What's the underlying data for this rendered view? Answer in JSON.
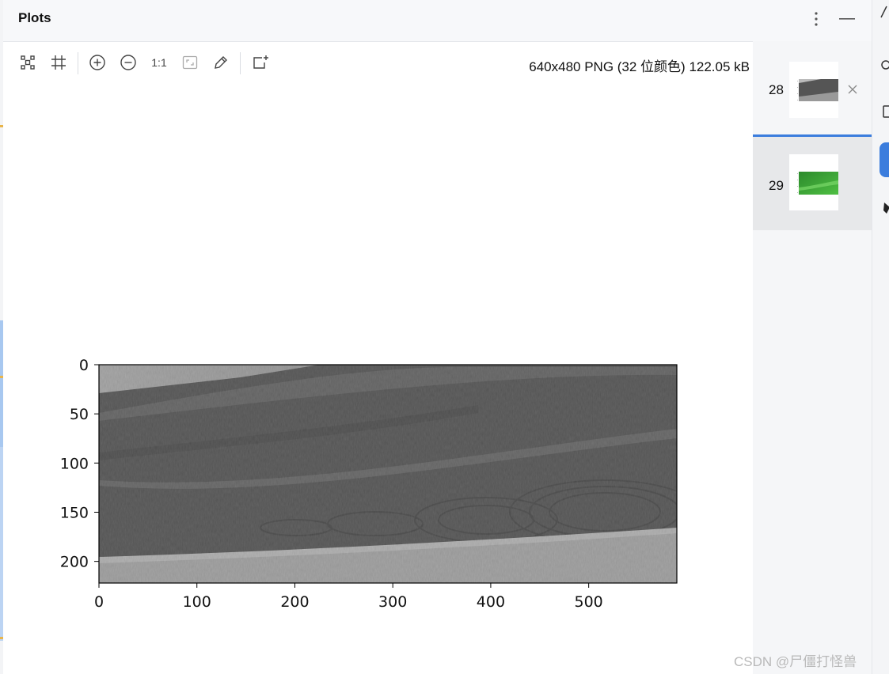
{
  "panel": {
    "title": "Plots",
    "more_icon": "kebab-menu-icon",
    "minimize_icon": "minimize-icon"
  },
  "toolbar": {
    "buttons": [
      {
        "name": "fit-to-view-icon"
      },
      {
        "name": "crop-icon"
      },
      {
        "name": "zoom-in-icon"
      },
      {
        "name": "zoom-out-icon"
      },
      {
        "name": "actual-size-icon",
        "label": "1:1"
      },
      {
        "name": "fit-window-icon"
      },
      {
        "name": "color-picker-icon"
      },
      {
        "name": "new-plot-icon"
      }
    ],
    "image_info": "640x480 PNG (32 位颜色) 122.05 kB"
  },
  "history": {
    "items": [
      {
        "number": "28",
        "thumbnail": "grayscale-landscape-thumbnail",
        "selected": false,
        "close_icon": "close-icon"
      },
      {
        "number": "29",
        "thumbnail": "green-landscape-thumbnail",
        "selected": true
      }
    ]
  },
  "chart_data": {
    "type": "image",
    "description_source": "matplotlib imshow of grayscale field image",
    "title": "",
    "xlabel": "",
    "ylabel": "",
    "xlim": [
      0,
      590
    ],
    "ylim": [
      222,
      0
    ],
    "xticks": [
      0,
      100,
      200,
      300,
      400,
      500
    ],
    "yticks": [
      0,
      50,
      100,
      150,
      200
    ],
    "colormap": "gray"
  },
  "colors": {
    "accent": "#3b7ddd",
    "header_bg": "#f7f8fa",
    "selected_bg": "#e7e8ea",
    "watermark": "#b9b9b9"
  },
  "watermark": "CSDN @尸僵打怪兽"
}
